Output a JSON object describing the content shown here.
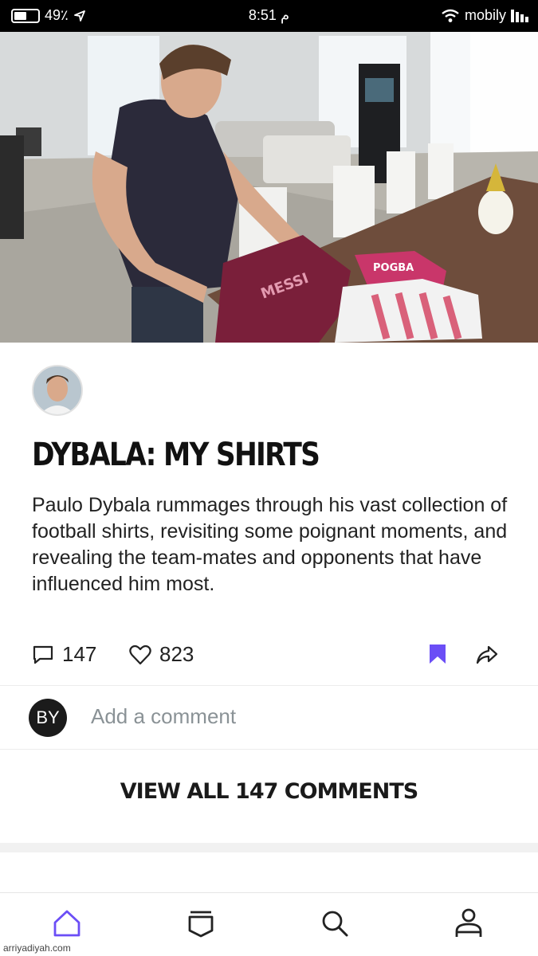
{
  "status_bar": {
    "battery": "49٪",
    "time": "8:51 م",
    "carrier": "mobily"
  },
  "video": {
    "jersey_left_text": "MESSI",
    "jersey_right_text": "POGBA"
  },
  "post": {
    "title": "DYBALA: MY SHIRTS",
    "description": "Paulo Dybala rummages through his vast collection of football shirts, revisiting some poignant moments, and revealing the team-mates and opponents that have influenced him most.",
    "comment_count": "147",
    "like_count": "823"
  },
  "comment_box": {
    "user_initials": "BY",
    "placeholder": "Add a comment"
  },
  "view_all_label": "VIEW ALL 147 COMMENTS",
  "tabs": [
    "home-icon",
    "feed-icon",
    "search-icon",
    "profile-icon"
  ],
  "colors": {
    "accent": "#6b4ef6",
    "text": "#1a1a1a"
  },
  "watermark": "arriyadiyah.com"
}
